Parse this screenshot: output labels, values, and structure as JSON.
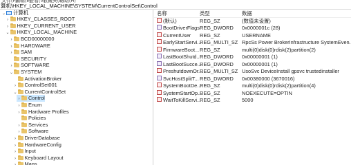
{
  "menubar": [
    "文件(F)",
    "编辑(E)",
    "查看(V)",
    "收藏夹(A)",
    "帮助(H)"
  ],
  "address": "算机\\HKEY_LOCAL_MACHINE\\SYSTEM\\CurrentControlSet\\Control",
  "tree": [
    {
      "label": "计算机",
      "arrow": "v",
      "icon": "computer"
    },
    {
      "label": "HKEY_CLASSES_ROOT",
      "arrow": ">",
      "icon": "folder"
    },
    {
      "label": "HKEY_CURRENT_USER",
      "arrow": ">",
      "icon": "folder"
    },
    {
      "label": "HKEY_LOCAL_MACHINE",
      "arrow": "v",
      "icon": "folder"
    },
    {
      "label": "BCD00000000",
      "arrow": ">",
      "icon": "folder"
    },
    {
      "label": "HARDWARE",
      "arrow": ">",
      "icon": "folder"
    },
    {
      "label": "SAM",
      "arrow": ">",
      "icon": "folder"
    },
    {
      "label": "SECURITY",
      "arrow": "",
      "icon": "folder"
    },
    {
      "label": "SOFTWARE",
      "arrow": ">",
      "icon": "folder"
    },
    {
      "label": "SYSTEM",
      "arrow": "v",
      "icon": "folder"
    },
    {
      "label": "ActivationBroker",
      "arrow": "",
      "icon": "folder"
    },
    {
      "label": "ControlSet001",
      "arrow": ">",
      "icon": "folder"
    },
    {
      "label": "CurrentControlSet",
      "arrow": "v",
      "icon": "folder"
    },
    {
      "label": "Control",
      "arrow": ">",
      "icon": "folder",
      "selected": true
    },
    {
      "label": "Enum",
      "arrow": ">",
      "icon": "folder"
    },
    {
      "label": "Hardware Profiles",
      "arrow": ">",
      "icon": "folder"
    },
    {
      "label": "Policies",
      "arrow": "",
      "icon": "folder"
    },
    {
      "label": "Services",
      "arrow": ">",
      "icon": "folder"
    },
    {
      "label": "Software",
      "arrow": ">",
      "icon": "folder"
    },
    {
      "label": "DriverDatabase",
      "arrow": ">",
      "icon": "folder"
    },
    {
      "label": "HardwareConfig",
      "arrow": ">",
      "icon": "folder"
    },
    {
      "label": "Input",
      "arrow": ">",
      "icon": "folder"
    },
    {
      "label": "Keyboard Layout",
      "arrow": ">",
      "icon": "folder"
    },
    {
      "label": "Maps",
      "arrow": ">",
      "icon": "folder"
    }
  ],
  "columns": {
    "name": "名称",
    "type": "类型",
    "data": "数据"
  },
  "values": [
    {
      "name": "(默认)",
      "type": "REG_SZ",
      "data": "(数值未设置)",
      "kind": "sz"
    },
    {
      "name": "BootDriverFlags",
      "type": "REG_DWORD",
      "data": "0x0000001c (28)",
      "kind": "bin"
    },
    {
      "name": "CurrentUser",
      "type": "REG_SZ",
      "data": "USERNAME",
      "kind": "sz"
    },
    {
      "name": "EarlyStartServi...",
      "type": "REG_MULTI_SZ",
      "data": "RpcSs Power BrokerInfrastructure SystemEven...",
      "kind": "sz"
    },
    {
      "name": "FirmwareBoot...",
      "type": "REG_SZ",
      "data": "multi(0)disk(0)rdisk(2)partition(2)",
      "kind": "sz"
    },
    {
      "name": "LastBootShutd...",
      "type": "REG_DWORD",
      "data": "0x00000001 (1)",
      "kind": "bin"
    },
    {
      "name": "LastBootSucce...",
      "type": "REG_DWORD",
      "data": "0x00000001 (1)",
      "kind": "bin"
    },
    {
      "name": "PreshutdownOr...",
      "type": "REG_MULTI_SZ",
      "data": "UsoSvc DeviceInstall gpsvc trustedinstaller",
      "kind": "sz"
    },
    {
      "name": "SvcHostSplitT...",
      "type": "REG_DWORD",
      "data": "0x00380000 (3670016)",
      "kind": "bin"
    },
    {
      "name": "SystemBootDe...",
      "type": "REG_SZ",
      "data": "multi(0)disk(0)rdisk(2)partition(4)",
      "kind": "sz"
    },
    {
      "name": "SystemStartOp...",
      "type": "REG_SZ",
      "data": "NOEXECUTE=OPTIN",
      "kind": "sz"
    },
    {
      "name": "WaitToKillServi...",
      "type": "REG_SZ",
      "data": "5000",
      "kind": "sz"
    }
  ]
}
